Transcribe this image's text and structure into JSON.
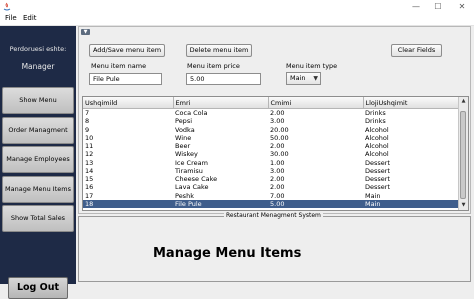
{
  "window": {
    "minimize": "—",
    "maximize": "☐",
    "close": "✕"
  },
  "menu": {
    "file": "File",
    "edit": "Edit"
  },
  "sidebar": {
    "greeting": "Perdoruesi eshte:",
    "role": "Manager",
    "buttons": [
      "Show Menu",
      "Order Managment",
      "Manage Employees",
      "Manage Menu Items",
      "Show Total Sales"
    ],
    "logout": "Log Out"
  },
  "toolbar": {
    "add_save": "Add/Save menu item",
    "delete": "Delete menu item",
    "clear": "Clear Fields"
  },
  "form": {
    "name_label": "Menu item name",
    "name_value": "File Pule",
    "price_label": "Menu item price",
    "price_value": "5.00",
    "type_label": "Menu item type",
    "type_value": "Main"
  },
  "table": {
    "columns": [
      "Ushqimild",
      "Emri",
      "Cmimi",
      "LlojiUshqimit"
    ],
    "rows": [
      [
        "7",
        "Coca Cola",
        "2.00",
        "Drinks"
      ],
      [
        "8",
        "Pepsi",
        "3.00",
        "Drinks"
      ],
      [
        "9",
        "Vodka",
        "20.00",
        "Alcohol"
      ],
      [
        "10",
        "Wine",
        "50.00",
        "Alcohol"
      ],
      [
        "11",
        "Beer",
        "2.00",
        "Alcohol"
      ],
      [
        "12",
        "Wiskey",
        "30.00",
        "Alcohol"
      ],
      [
        "13",
        "Ice Cream",
        "1.00",
        "Dessert"
      ],
      [
        "14",
        "Tiramisu",
        "3.00",
        "Dessert"
      ],
      [
        "15",
        "Cheese Cake",
        "2.00",
        "Dessert"
      ],
      [
        "16",
        "Lava Cake",
        "2.00",
        "Dessert"
      ],
      [
        "17",
        "Peshk",
        "7.00",
        "Main"
      ],
      [
        "18",
        "File Pule",
        "5.00",
        "Main"
      ]
    ],
    "selected_row": 11
  },
  "bottom": {
    "legend": "Restaurant Menagment System",
    "heading": "Manage Menu Items"
  },
  "colors": {
    "sidebar": "#1e2a46",
    "selection": "#3f5e8c"
  }
}
